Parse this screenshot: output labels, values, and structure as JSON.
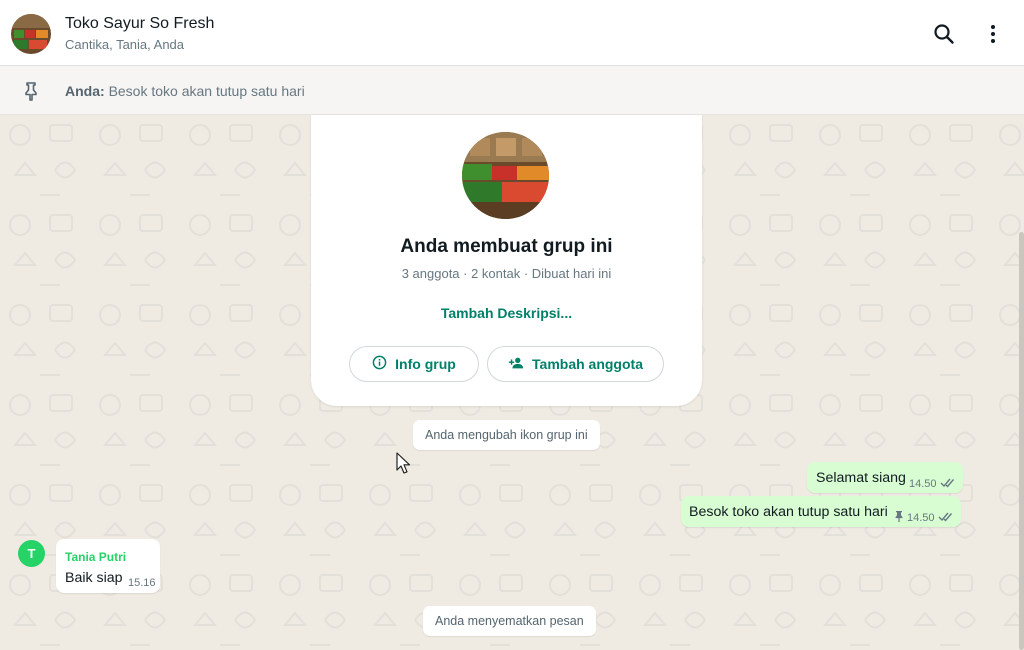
{
  "header": {
    "title": "Toko Sayur So Fresh",
    "subtitle": "Cantika, Tania, Anda",
    "icons": [
      "search-icon",
      "menu-icon"
    ]
  },
  "pinned": {
    "author": "Anda:",
    "text": "Besok toko akan tutup satu hari"
  },
  "card": {
    "title": "Anda membuat grup ini",
    "meta": "3 anggota · 2 kontak · Dibuat hari ini",
    "description_link": "Tambah Deskripsi...",
    "info_button": "Info grup",
    "add_member_button": "Tambah anggota"
  },
  "system_messages": {
    "icon_changed": "Anda mengubah ikon grup ini",
    "pinned_message": "Anda menyematkan pesan"
  },
  "messages": [
    {
      "text": "Selamat siang",
      "time": "14.50",
      "outgoing": true
    },
    {
      "text": "Besok toko akan tutup satu hari",
      "time": "14.50",
      "outgoing": true,
      "pinned": true
    },
    {
      "sender": "Tania Putri",
      "sender_initial": "T",
      "text": "Baik siap",
      "time": "15.16",
      "outgoing": false
    }
  ],
  "colors": {
    "accent": "#008069",
    "chat_bg": "#efeae2",
    "outgoing_bubble": "#d9fdd3",
    "sender_name": "#25d366"
  }
}
